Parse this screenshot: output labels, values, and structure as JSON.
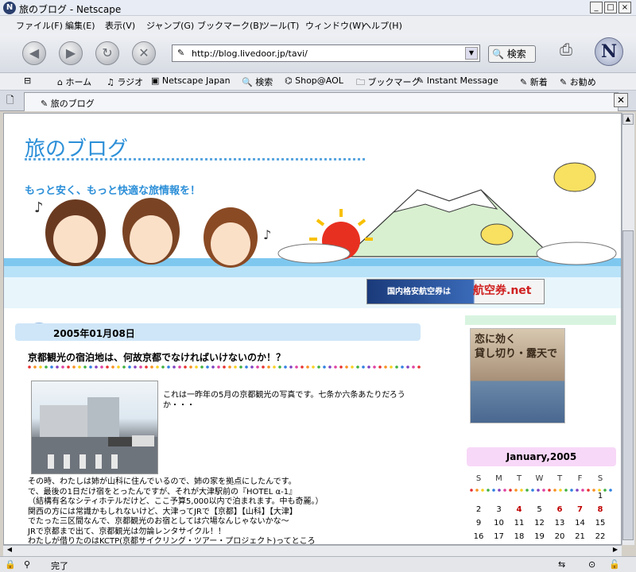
{
  "window": {
    "title": "旅のブログ - Netscape",
    "min": "_",
    "max": "□",
    "close": "×"
  },
  "menu": [
    "ファイル(F)",
    "編集(E)",
    "表示(V)",
    "ジャンプ(G)",
    "ブックマーク(B)",
    "ツール(T)",
    "ウィンドウ(W)",
    "ヘルプ(H)"
  ],
  "nav": {
    "url": "http://blog.livedoor.jp/tavi/",
    "search_label": "検索"
  },
  "bookmarks": [
    "ホーム",
    "ラジオ",
    "Netscape Japan",
    "検索",
    "Shop@AOL",
    "ブックマーク",
    "Instant Message",
    "新着",
    "お勧め"
  ],
  "tab": {
    "label": "旅のブログ"
  },
  "blog": {
    "title": "旅のブログ",
    "tagline": "もっと安く、もっと快適な旅情報を！",
    "ad_banner_left": "国内格安航空券は",
    "ad_banner_right": "航空券.net",
    "date": "2005年01月08日",
    "post_title": "京都観光の宿泊地は、何故京都でなければいけないのか！？",
    "photo_caption": "これは一昨年の5月の京都観光の写真です。七条か六条あたりだろうか・・・",
    "body_lines": [
      "その時、わたしは姉が山科に住んでいるので、姉の家を拠点にしたんです。",
      "で、最後の1日だけ宿をとったんですが、それが大津駅前の『HOTEL α-1』",
      "（結構有名なシティホテルだけど、ここ予算5,000以内で泊まれます。中も奇麗。）",
      "関西の方には常識かもしれないけど、大津ってJRで【京都】【山科】【大津】",
      "でたった三区間なんで、京都観光のお宿としては穴場なんじゃないかな～",
      "JRで京都まで出て、京都観光は勿論レンタサイクル！！",
      "わたしが借りたのはKCTP(京都サイクリング・ツアー・プロジェクト)ってところ"
    ]
  },
  "sidebar": {
    "ad_line1": "恋に効く",
    "ad_line2": "貸し切り・露天で",
    "calendar_title": "January,2005",
    "weekdays": [
      "S",
      "M",
      "T",
      "W",
      "T",
      "F",
      "S"
    ],
    "weeks": [
      [
        "",
        "",
        "",
        "",
        "",
        "",
        "1"
      ],
      [
        "2",
        "3",
        "4",
        "5",
        "6",
        "7",
        "8"
      ],
      [
        "9",
        "10",
        "11",
        "12",
        "13",
        "14",
        "15"
      ],
      [
        "16",
        "17",
        "18",
        "19",
        "20",
        "21",
        "22"
      ]
    ],
    "red_days": [
      "4",
      "6",
      "7",
      "8"
    ]
  },
  "status": {
    "text": "完了"
  },
  "colors": {
    "title_blue": "#2c8fd8",
    "date_bar": "#cfe6f8",
    "cal_head": "#f8d8f8",
    "red_day": "#c00000"
  }
}
